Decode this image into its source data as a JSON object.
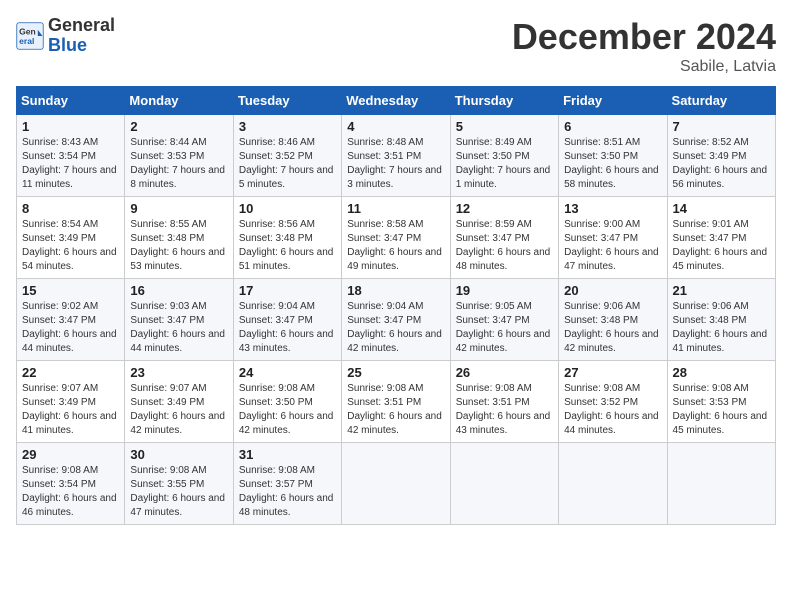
{
  "header": {
    "logo_line1": "General",
    "logo_line2": "Blue",
    "month": "December 2024",
    "location": "Sabile, Latvia"
  },
  "columns": [
    "Sunday",
    "Monday",
    "Tuesday",
    "Wednesday",
    "Thursday",
    "Friday",
    "Saturday"
  ],
  "weeks": [
    [
      {
        "day": 1,
        "sunrise": "Sunrise: 8:43 AM",
        "sunset": "Sunset: 3:54 PM",
        "daylight": "Daylight: 7 hours and 11 minutes."
      },
      {
        "day": 2,
        "sunrise": "Sunrise: 8:44 AM",
        "sunset": "Sunset: 3:53 PM",
        "daylight": "Daylight: 7 hours and 8 minutes."
      },
      {
        "day": 3,
        "sunrise": "Sunrise: 8:46 AM",
        "sunset": "Sunset: 3:52 PM",
        "daylight": "Daylight: 7 hours and 5 minutes."
      },
      {
        "day": 4,
        "sunrise": "Sunrise: 8:48 AM",
        "sunset": "Sunset: 3:51 PM",
        "daylight": "Daylight: 7 hours and 3 minutes."
      },
      {
        "day": 5,
        "sunrise": "Sunrise: 8:49 AM",
        "sunset": "Sunset: 3:50 PM",
        "daylight": "Daylight: 7 hours and 1 minute."
      },
      {
        "day": 6,
        "sunrise": "Sunrise: 8:51 AM",
        "sunset": "Sunset: 3:50 PM",
        "daylight": "Daylight: 6 hours and 58 minutes."
      },
      {
        "day": 7,
        "sunrise": "Sunrise: 8:52 AM",
        "sunset": "Sunset: 3:49 PM",
        "daylight": "Daylight: 6 hours and 56 minutes."
      }
    ],
    [
      {
        "day": 8,
        "sunrise": "Sunrise: 8:54 AM",
        "sunset": "Sunset: 3:49 PM",
        "daylight": "Daylight: 6 hours and 54 minutes."
      },
      {
        "day": 9,
        "sunrise": "Sunrise: 8:55 AM",
        "sunset": "Sunset: 3:48 PM",
        "daylight": "Daylight: 6 hours and 53 minutes."
      },
      {
        "day": 10,
        "sunrise": "Sunrise: 8:56 AM",
        "sunset": "Sunset: 3:48 PM",
        "daylight": "Daylight: 6 hours and 51 minutes."
      },
      {
        "day": 11,
        "sunrise": "Sunrise: 8:58 AM",
        "sunset": "Sunset: 3:47 PM",
        "daylight": "Daylight: 6 hours and 49 minutes."
      },
      {
        "day": 12,
        "sunrise": "Sunrise: 8:59 AM",
        "sunset": "Sunset: 3:47 PM",
        "daylight": "Daylight: 6 hours and 48 minutes."
      },
      {
        "day": 13,
        "sunrise": "Sunrise: 9:00 AM",
        "sunset": "Sunset: 3:47 PM",
        "daylight": "Daylight: 6 hours and 47 minutes."
      },
      {
        "day": 14,
        "sunrise": "Sunrise: 9:01 AM",
        "sunset": "Sunset: 3:47 PM",
        "daylight": "Daylight: 6 hours and 45 minutes."
      }
    ],
    [
      {
        "day": 15,
        "sunrise": "Sunrise: 9:02 AM",
        "sunset": "Sunset: 3:47 PM",
        "daylight": "Daylight: 6 hours and 44 minutes."
      },
      {
        "day": 16,
        "sunrise": "Sunrise: 9:03 AM",
        "sunset": "Sunset: 3:47 PM",
        "daylight": "Daylight: 6 hours and 44 minutes."
      },
      {
        "day": 17,
        "sunrise": "Sunrise: 9:04 AM",
        "sunset": "Sunset: 3:47 PM",
        "daylight": "Daylight: 6 hours and 43 minutes."
      },
      {
        "day": 18,
        "sunrise": "Sunrise: 9:04 AM",
        "sunset": "Sunset: 3:47 PM",
        "daylight": "Daylight: 6 hours and 42 minutes."
      },
      {
        "day": 19,
        "sunrise": "Sunrise: 9:05 AM",
        "sunset": "Sunset: 3:47 PM",
        "daylight": "Daylight: 6 hours and 42 minutes."
      },
      {
        "day": 20,
        "sunrise": "Sunrise: 9:06 AM",
        "sunset": "Sunset: 3:48 PM",
        "daylight": "Daylight: 6 hours and 42 minutes."
      },
      {
        "day": 21,
        "sunrise": "Sunrise: 9:06 AM",
        "sunset": "Sunset: 3:48 PM",
        "daylight": "Daylight: 6 hours and 41 minutes."
      }
    ],
    [
      {
        "day": 22,
        "sunrise": "Sunrise: 9:07 AM",
        "sunset": "Sunset: 3:49 PM",
        "daylight": "Daylight: 6 hours and 41 minutes."
      },
      {
        "day": 23,
        "sunrise": "Sunrise: 9:07 AM",
        "sunset": "Sunset: 3:49 PM",
        "daylight": "Daylight: 6 hours and 42 minutes."
      },
      {
        "day": 24,
        "sunrise": "Sunrise: 9:08 AM",
        "sunset": "Sunset: 3:50 PM",
        "daylight": "Daylight: 6 hours and 42 minutes."
      },
      {
        "day": 25,
        "sunrise": "Sunrise: 9:08 AM",
        "sunset": "Sunset: 3:51 PM",
        "daylight": "Daylight: 6 hours and 42 minutes."
      },
      {
        "day": 26,
        "sunrise": "Sunrise: 9:08 AM",
        "sunset": "Sunset: 3:51 PM",
        "daylight": "Daylight: 6 hours and 43 minutes."
      },
      {
        "day": 27,
        "sunrise": "Sunrise: 9:08 AM",
        "sunset": "Sunset: 3:52 PM",
        "daylight": "Daylight: 6 hours and 44 minutes."
      },
      {
        "day": 28,
        "sunrise": "Sunrise: 9:08 AM",
        "sunset": "Sunset: 3:53 PM",
        "daylight": "Daylight: 6 hours and 45 minutes."
      }
    ],
    [
      {
        "day": 29,
        "sunrise": "Sunrise: 9:08 AM",
        "sunset": "Sunset: 3:54 PM",
        "daylight": "Daylight: 6 hours and 46 minutes."
      },
      {
        "day": 30,
        "sunrise": "Sunrise: 9:08 AM",
        "sunset": "Sunset: 3:55 PM",
        "daylight": "Daylight: 6 hours and 47 minutes."
      },
      {
        "day": 31,
        "sunrise": "Sunrise: 9:08 AM",
        "sunset": "Sunset: 3:57 PM",
        "daylight": "Daylight: 6 hours and 48 minutes."
      },
      null,
      null,
      null,
      null
    ]
  ]
}
